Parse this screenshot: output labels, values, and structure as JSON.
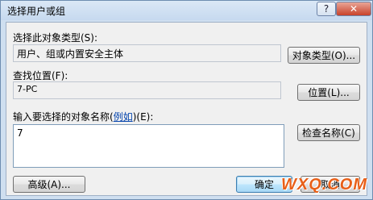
{
  "window": {
    "title": "选择用户或组",
    "help_label": "?",
    "close_label": "✕"
  },
  "object_type": {
    "label": "选择此对象类型(S):",
    "value": "用户、组或内置安全主体",
    "button": "对象类型(O)..."
  },
  "location": {
    "label": "查找位置(F):",
    "value": "7-PC",
    "button": "位置(L)..."
  },
  "names": {
    "label_prefix": "输入要选择的对象名称(",
    "label_link": "例如",
    "label_suffix": ")(E):",
    "value": "7",
    "check_button": "检查名称(C)"
  },
  "footer": {
    "advanced_button": "高级(A)...",
    "ok_button": "确定",
    "cancel_button": "取消"
  },
  "watermark": "WXQ.COM"
}
